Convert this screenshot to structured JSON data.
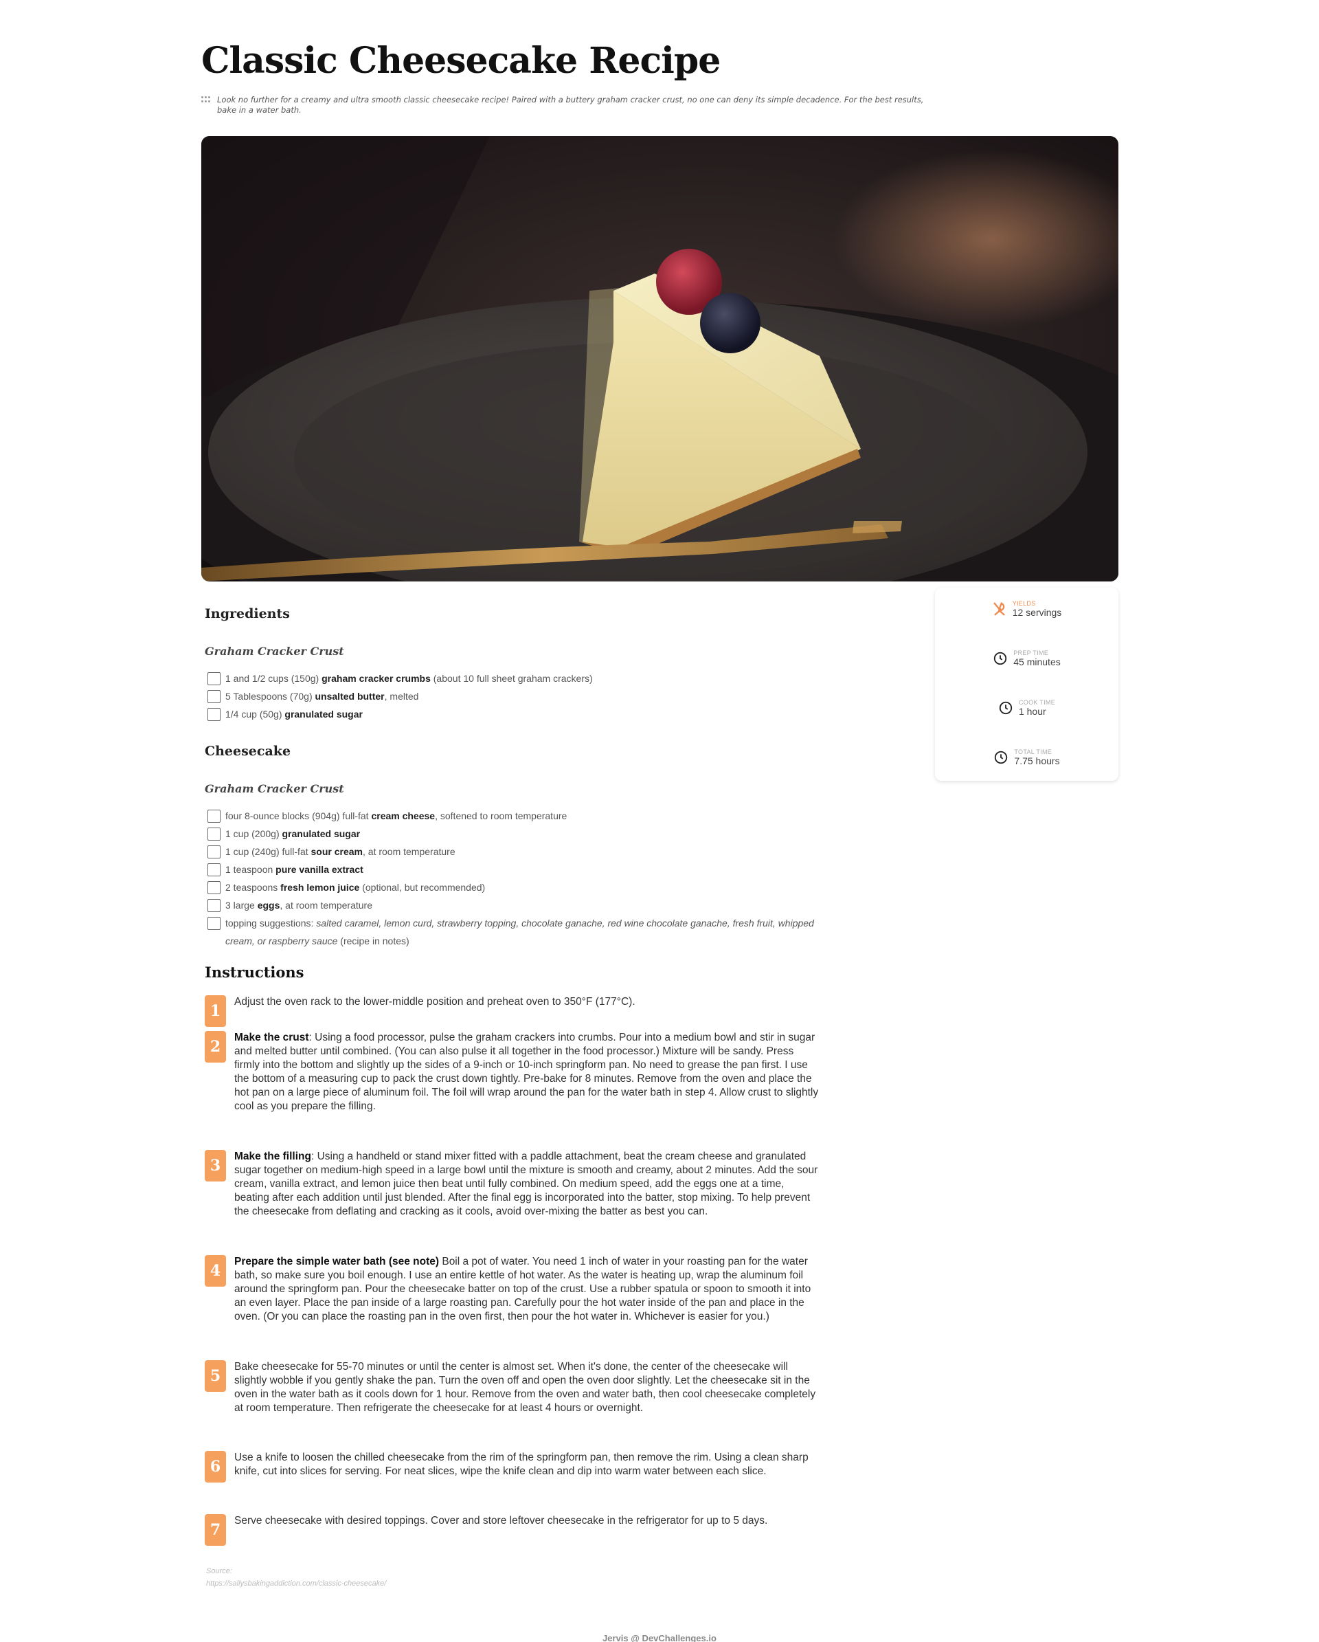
{
  "page": {
    "title": "Classic Cheesecake Recipe",
    "intro": "Look no further for a creamy and ultra smooth classic cheesecake recipe! Paired with a buttery graham cracker crust, no one can deny its simple decadence. For the best results, bake in a water bath."
  },
  "stats": {
    "yields": {
      "label": "YIELDS",
      "value": "12 servings",
      "icon": "utensils-icon"
    },
    "prep": {
      "label": "PREP TIME",
      "value": "45 minutes",
      "icon": "clock-icon"
    },
    "cook": {
      "label": "COOK TIME",
      "value": "1 hour",
      "icon": "clock-icon"
    },
    "total": {
      "label": "TOTAL TIME",
      "value": "7.75 hours",
      "icon": "clock-icon"
    }
  },
  "ingredients": {
    "heading": "Ingredients",
    "section1": {
      "title": "Graham Cracker Crust",
      "items": [
        {
          "pre": "1 and 1/2 cups (150g) ",
          "bold": "graham cracker crumbs",
          "post": " (about 10 full sheet graham crackers)"
        },
        {
          "pre": "5 Tablespoons (70g) ",
          "bold": "unsalted butter",
          "post": ", melted"
        },
        {
          "pre": "1/4 cup (50g) ",
          "bold": "granulated sugar",
          "post": ""
        }
      ]
    },
    "section2": {
      "heading": "Cheesecake",
      "title": "Graham Cracker Crust",
      "items": [
        {
          "pre": "four 8-ounce blocks (904g) full-fat ",
          "bold": "cream cheese",
          "post": ", softened to room temperature"
        },
        {
          "pre": "1 cup (200g) ",
          "bold": "granulated sugar",
          "post": ""
        },
        {
          "pre": "1 cup (240g) full-fat ",
          "bold": "sour cream",
          "post": ", at room temperature"
        },
        {
          "pre": "1 teaspoon ",
          "bold": "pure vanilla extract",
          "post": ""
        },
        {
          "pre": "2 teaspoons ",
          "bold": "fresh lemon juice",
          "post": " (optional, but recommended)"
        },
        {
          "pre": "3 large ",
          "bold": "eggs",
          "post": ", at room temperature"
        }
      ],
      "topping": {
        "pre": "topping suggestions: ",
        "italic": "salted caramel, lemon curd, strawberry topping, chocolate ganache, red wine chocolate ganache, fresh fruit, whipped cream, or raspberry sauce",
        "post": " (recipe in notes)"
      }
    }
  },
  "instructions": {
    "heading": "Instructions",
    "steps": [
      {
        "num": "1",
        "bold": "",
        "text": "Adjust the oven rack to the lower-middle position and preheat oven to 350°F (177°C)."
      },
      {
        "num": "2",
        "bold": "Make the crust",
        "text": ": Using a food processor, pulse the graham crackers into crumbs. Pour into a medium bowl and stir in sugar and melted butter until combined. (You can also pulse it all together in the food processor.) Mixture will be sandy. Press firmly into the bottom and slightly up the sides of a 9-inch or 10-inch springform pan. No need to grease the pan first. I use the bottom of a measuring cup to pack the crust down tightly. Pre-bake for 8 minutes. Remove from the oven and place the hot pan on a large piece of aluminum foil. The foil will wrap around the pan for the water bath in step 4. Allow crust to slightly cool as you prepare the filling."
      },
      {
        "num": "3",
        "bold": "Make the filling",
        "text": ": Using a handheld or stand mixer fitted with a paddle attachment, beat the cream cheese and granulated sugar together on medium-high speed in a large bowl until the mixture is smooth and creamy, about 2 minutes. Add the sour cream, vanilla extract, and lemon juice then beat until fully combined. On medium speed, add the eggs one at a time, beating after each addition until just blended. After the final egg is incorporated into the batter, stop mixing. To help prevent the cheesecake from deflating and cracking as it cools, avoid over-mixing the batter as best you can."
      },
      {
        "num": "4",
        "bold": "Prepare the simple water bath (see note)",
        "text": " Boil a pot of water. You need 1 inch of water in your roasting pan for the water bath, so make sure you boil enough. I use an entire kettle of hot water. As the water is heating up, wrap the aluminum foil around the springform pan. Pour the cheesecake batter on top of the crust. Use a rubber spatula or spoon to smooth it into an even layer. Place the pan inside of a large roasting pan. Carefully pour the hot water inside of the pan and place in the oven. (Or you can place the roasting pan in the oven first, then pour the hot water in. Whichever is easier for you.)"
      },
      {
        "num": "5",
        "bold": "",
        "text": "Bake cheesecake for 55-70 minutes or until the center is almost set. When it's done, the center of the cheesecake will slightly wobble if you gently shake the pan. Turn the oven off and open the oven door slightly. Let the cheesecake sit in the oven in the water bath as it cools down for 1 hour. Remove from the oven and water bath, then cool cheesecake completely at room temperature. Then refrigerate the cheesecake for at least 4 hours or overnight."
      },
      {
        "num": "6",
        "bold": "",
        "text": "Use a knife to loosen the chilled cheesecake from the rim of the springform pan, then remove the rim. Using a clean sharp knife, cut into slices for serving. For neat slices, wipe the knife clean and dip into warm water between each slice."
      },
      {
        "num": "7",
        "bold": "",
        "text": "Serve cheesecake with desired toppings. Cover and store leftover cheesecake in the refrigerator for up to 5 days."
      }
    ]
  },
  "source": {
    "label": "Source:",
    "url": "https://sallysbakingaddiction.com/classic-cheesecake/"
  },
  "footer": "Jervis @ DevChallenges.io",
  "colors": {
    "accent": "#f5a05c",
    "accent_text": "#f0894e"
  }
}
